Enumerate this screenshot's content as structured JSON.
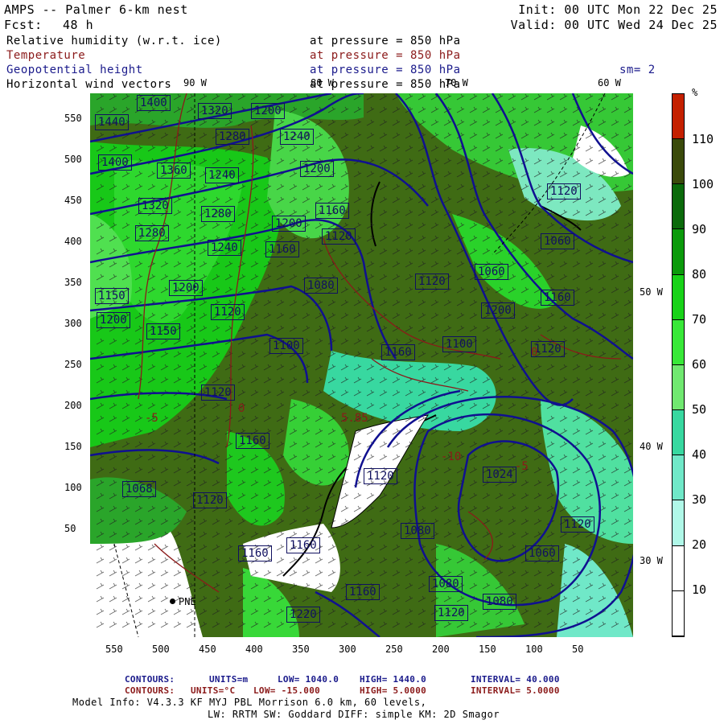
{
  "header": {
    "model": "AMPS -- Palmer 6-km nest",
    "fcst_label": "Fcst:",
    "fcst_value": "48 h",
    "init": "Init: 00 UTC Mon 22 Dec 25",
    "valid": "Valid: 00 UTC Wed 24 Dec 25"
  },
  "fields": [
    {
      "name": "Relative humidity (w.r.t. ice)",
      "level": "at pressure =  850 hPa",
      "color": "#000000"
    },
    {
      "name": "Temperature",
      "level": "at pressure =  850 hPa",
      "color": "#8b1a1a"
    },
    {
      "name": "Geopotential height",
      "level": "at pressure =  850 hPa",
      "color": "#1a1a8b",
      "extra": "sm= 2"
    },
    {
      "name": "Horizontal wind vectors",
      "level": "at pressure =  850 hPa",
      "color": "#000000"
    }
  ],
  "map": {
    "y_ticks": [
      "550",
      "500",
      "450",
      "400",
      "350",
      "300",
      "250",
      "200",
      "150",
      "100",
      "50"
    ],
    "x_ticks": [
      "550",
      "500",
      "450",
      "400",
      "350",
      "300",
      "250",
      "200",
      "150",
      "100",
      "50"
    ],
    "lon_top": [
      "90 W",
      "80 W",
      "70 W",
      "60 W"
    ],
    "lon_right": [
      "50 W",
      "40 W",
      "30 W"
    ],
    "station": "PNE",
    "height_labels": [
      "1440",
      "1400",
      "1400",
      "1360",
      "1320",
      "1280",
      "1320",
      "1240",
      "1280",
      "1240",
      "1200",
      "1280",
      "1200",
      "1240",
      "1160",
      "1200",
      "1160",
      "1200",
      "1120",
      "1080",
      "1100",
      "1120",
      "1160",
      "1200",
      "1150",
      "1150",
      "1120",
      "1160",
      "1120",
      "1100",
      "1120",
      "1160",
      "1060",
      "1060",
      "1120",
      "1068",
      "1120",
      "1160",
      "1160",
      "1120",
      "1024",
      "1060",
      "1120",
      "1080",
      "1080",
      "1160",
      "1080",
      "1120",
      "1220",
      "1200"
    ],
    "temp_labels": [
      "5.85",
      "-5",
      "0",
      "-10",
      "-5",
      "0"
    ]
  },
  "colorbar": {
    "unit": "%",
    "labels": [
      "110",
      "100",
      "90",
      "80",
      "70",
      "60",
      "50",
      "40",
      "30",
      "20",
      "10"
    ],
    "colors": [
      "#c42000",
      "#3a4a0a",
      "#0a6a0a",
      "#0a9a0a",
      "#18d218",
      "#38e838",
      "#70e870",
      "#38d8a0",
      "#70e8c8",
      "#b0f8e8",
      "#ffffff",
      "#ffffff"
    ]
  },
  "footer": {
    "c1_label": "CONTOURS:",
    "c1_units": "UNITS=m",
    "c1_low": "LOW=  1040.0",
    "c1_high": "HIGH=  1440.0",
    "c1_int": "INTERVAL=   40.000",
    "c2_label": "CONTOURS:",
    "c2_units": "UNITS=°C",
    "c2_low": "LOW= -15.000",
    "c2_high": "HIGH=  5.0000",
    "c2_int": "INTERVAL=   5.0000",
    "model_info": "Model Info: V4.3.3   KF      MYJ PBL  Morrison           6.0 km,  60 levels,",
    "model_info2": "LW: RRTM SW: Goddard DIFF: simple KM: 2D Smagor"
  }
}
